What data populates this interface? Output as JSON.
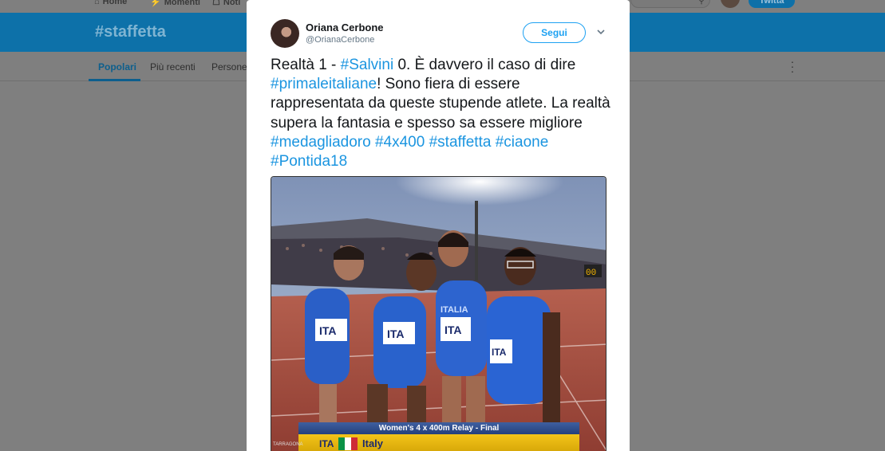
{
  "top_nav": {
    "home_label": "Home",
    "moments_label": "Momenti",
    "notifications_label": "Noti",
    "tweet_button": "Twitta"
  },
  "header": {
    "hashtag_title": "#staffetta"
  },
  "tabs": [
    {
      "label": "Popolari"
    },
    {
      "label": "Più recenti"
    },
    {
      "label": "Persone"
    }
  ],
  "tweet": {
    "author_name": "Oriana Cerbone",
    "author_handle": "@OrianaCerbone",
    "follow_label": "Segui",
    "text_parts": {
      "p1": "Realtà 1 - ",
      "h1": "#Salvini",
      "p2": " 0. È davvero il caso di dire ",
      "h2": "#primaleitaliane",
      "p3": "! Sono fiera di essere rappresentata da queste stupende atlete. La realtà supera la fantasia e spesso sa essere migliore ",
      "h3": "#medagliadoro",
      "h4": "#4x400",
      "h5": "#staffetta",
      "h6": "#ciaone",
      "h7": "#Pontida18"
    },
    "media": {
      "caption": "Women's 4 x 400m Relay - Final",
      "country_code": "ITA",
      "country_name": "Italy",
      "bib_text": "ITA",
      "jersey_text": "ITALIA",
      "scoreboard": "00",
      "logo_text": "TARRAGONA"
    }
  },
  "colors": {
    "brand_blue": "#1da1f2",
    "hashtag_blue": "#1b95e0",
    "overlay_bg": "#7f7f7f",
    "header_dim": "#0d71a9"
  },
  "icons": [
    "home-icon",
    "moments-icon",
    "bell-icon",
    "search-icon",
    "chevron-down-icon",
    "more-vertical-icon"
  ]
}
